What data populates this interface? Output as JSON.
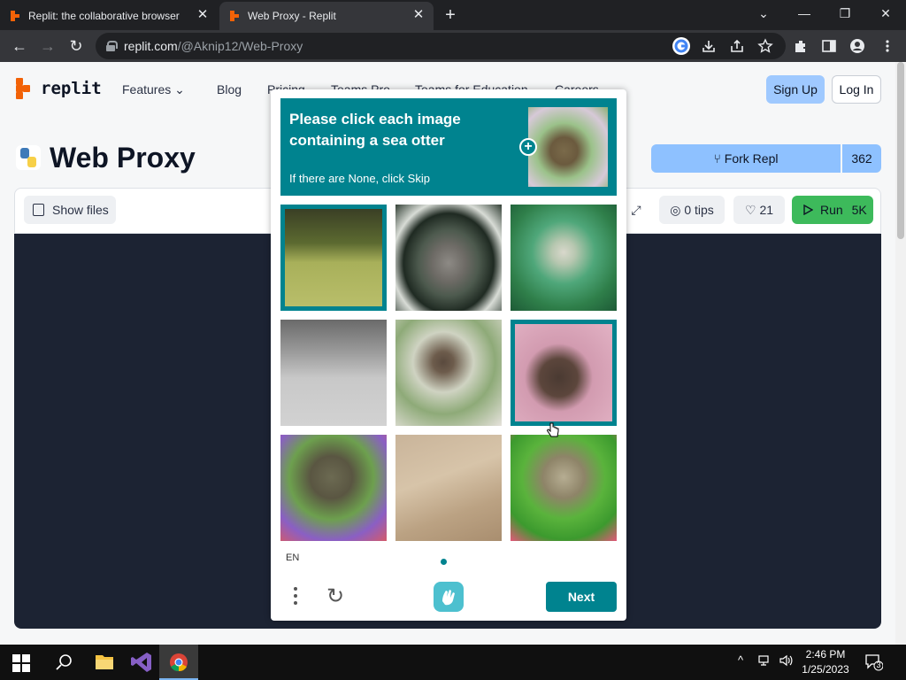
{
  "browser": {
    "tabs": [
      {
        "title": "Replit: the collaborative browser",
        "active": false
      },
      {
        "title": "Web Proxy - Replit",
        "active": true
      }
    ],
    "url_host": "replit.com",
    "url_path": "/@Aknip12/Web-Proxy",
    "nav": {
      "back": "←",
      "forward": "→",
      "reload": "↻"
    },
    "window_controls": {
      "tab_search": "⌄",
      "minimize": "—",
      "restore": "❐",
      "close": "✕"
    },
    "tab_close": "✕",
    "new_tab": "+"
  },
  "site": {
    "logo_text": "replit",
    "nav_items": [
      "Features",
      "Blog",
      "Pricing",
      "Teams Pro",
      "Teams for Education",
      "Careers"
    ],
    "features_caret": "⌄",
    "sign_up": "Sign Up",
    "log_in": "Log In",
    "repl_title": "Web Proxy",
    "fork_label": "Fork Repl",
    "fork_count": "362",
    "show_files": "Show files",
    "tips_label": "0 tips",
    "likes": "21",
    "run_label": "Run",
    "run_count": "5K"
  },
  "captcha": {
    "prompt": "Please click each image containing a sea otter",
    "sub": "If there are None, click Skip",
    "plus": "+",
    "language": "EN",
    "next_label": "Next",
    "refresh": "↻",
    "tiles": [
      {
        "subject": "grass-blur",
        "selected": true
      },
      {
        "subject": "rabbit-in-water",
        "selected": false
      },
      {
        "subject": "rabbit-in-foliage",
        "selected": false
      },
      {
        "subject": "rabbit-on-beach",
        "selected": false
      },
      {
        "subject": "rabbit-in-grass",
        "selected": false
      },
      {
        "subject": "sea-otter-pink",
        "selected": true
      },
      {
        "subject": "sea-otter-flowers",
        "selected": false
      },
      {
        "subject": "rabbit-on-sand",
        "selected": false
      },
      {
        "subject": "sea-otter-green",
        "selected": false
      }
    ]
  },
  "taskbar": {
    "time": "2:46 PM",
    "date": "1/25/2023",
    "notifications": "3"
  }
}
